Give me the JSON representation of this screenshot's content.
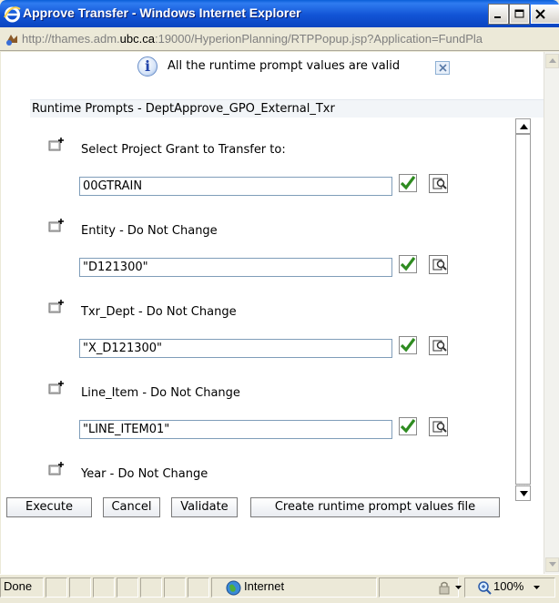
{
  "window": {
    "title": "Approve Transfer - Windows Internet Explorer",
    "url_prefix": "http://thames.adm.",
    "url_domain": "ubc.ca",
    "url_suffix": ":19000/HyperionPlanning/RTPPopup.jsp?Application=FundPla"
  },
  "info": {
    "icon": "info-icon",
    "message": "All the runtime prompt values are valid"
  },
  "header": {
    "title": "Runtime Prompts - DeptApprove_GPO_External_Txr"
  },
  "prompts": [
    {
      "label": "Select Project Grant to Transfer to:",
      "value": "00GTRAIN"
    },
    {
      "label": "Entity - Do Not Change",
      "value": "\"D121300\""
    },
    {
      "label": "Txr_Dept - Do Not Change",
      "value": "\"X_D121300\""
    },
    {
      "label": "Line_Item - Do Not Change",
      "value": "\"LINE_ITEM01\""
    },
    {
      "label": "Year - Do Not Change",
      "value": ""
    }
  ],
  "actions": {
    "execute": "Execute",
    "cancel": "Cancel",
    "validate": "Validate",
    "create_file": "Create runtime prompt values file"
  },
  "statusbar": {
    "status": "Done",
    "zone": "Internet",
    "zoom": "100%"
  },
  "colors": {
    "titlebar": "#0a44c0",
    "valid_check": "#2e8b20",
    "content_bg": "#ffffff"
  }
}
